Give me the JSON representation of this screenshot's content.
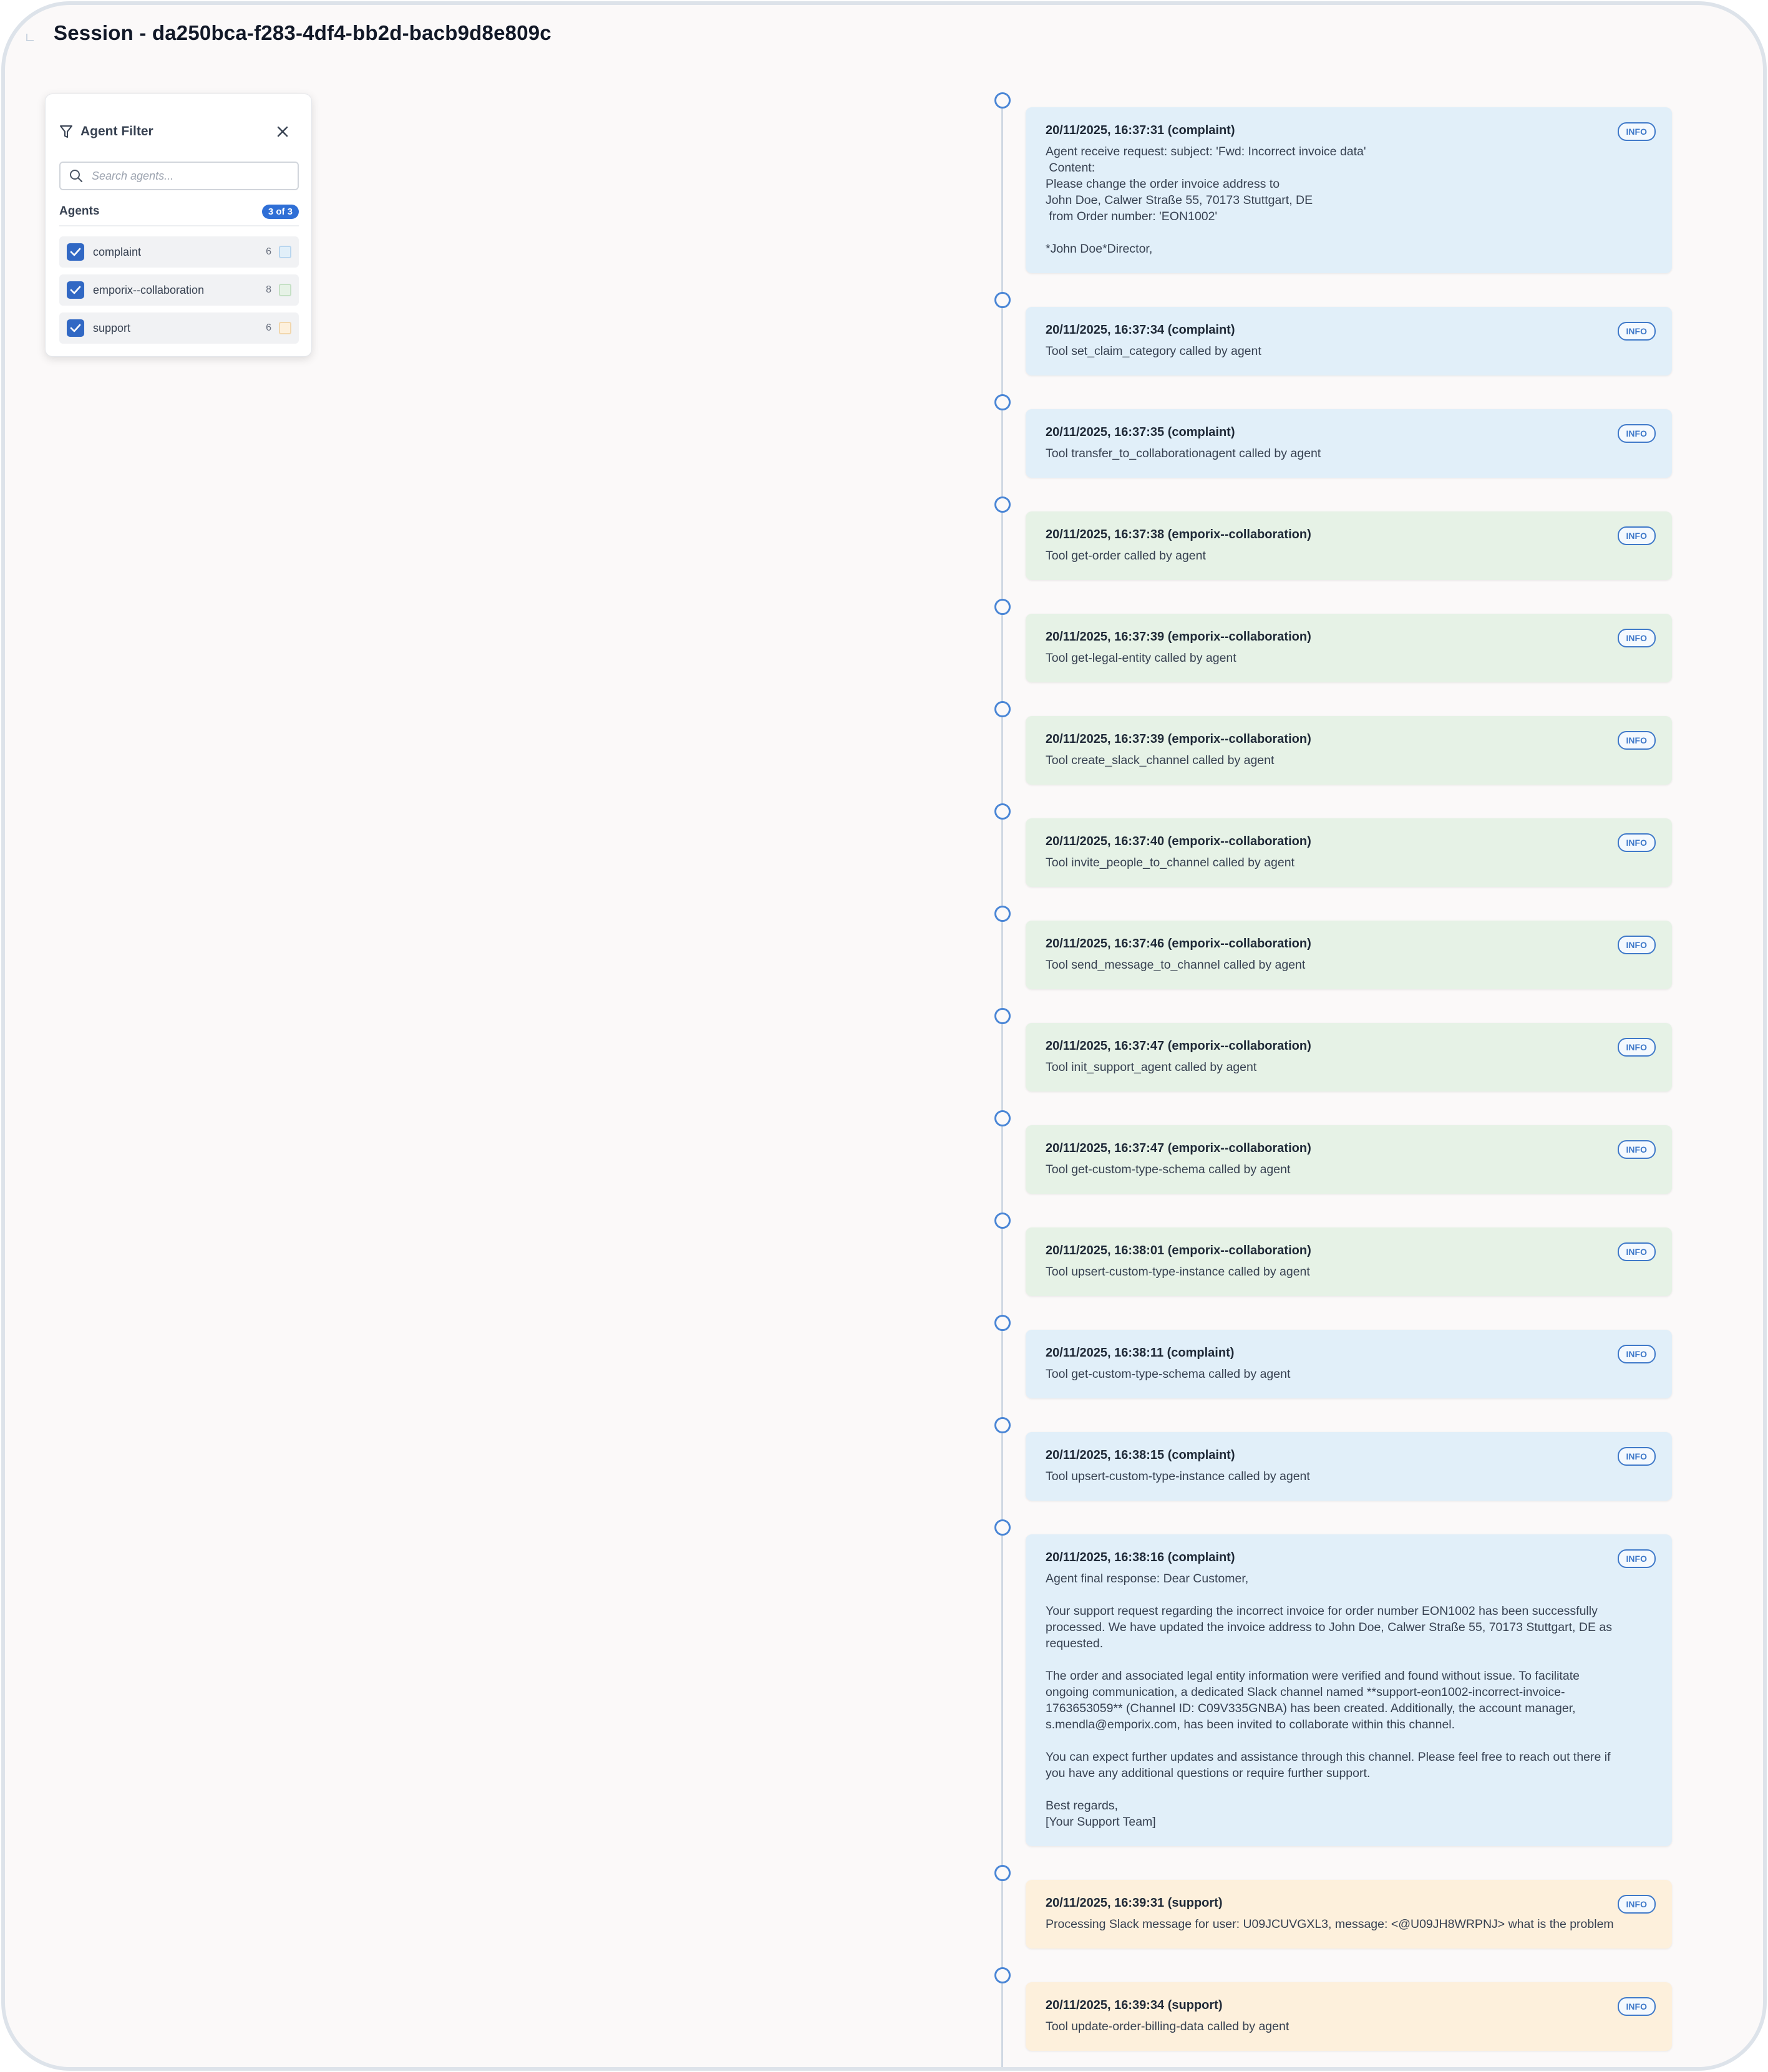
{
  "page": {
    "title": "Session - da250bca-f283-4df4-bb2d-bacb9d8e809c"
  },
  "filter": {
    "title": "Agent Filter",
    "search_placeholder": "Search agents...",
    "agents_label": "Agents",
    "count_badge": "3 of 3",
    "agents": [
      {
        "name": "complaint",
        "count": "6",
        "checked": true,
        "color": "#e1eff9"
      },
      {
        "name": "emporix--collaboration",
        "count": "8",
        "checked": true,
        "color": "#e6f2e6"
      },
      {
        "name": "support",
        "count": "6",
        "checked": true,
        "color": "#fdf0dc"
      }
    ]
  },
  "colors": {
    "complaint": "#e1eff9",
    "emporix": "#e6f2e6",
    "support": "#fdf0dc",
    "accent": "#2f6fd6",
    "badge": "#3f79c9"
  },
  "logs": [
    {
      "timestamp": "20/11/2025, 16:37:31 (complaint)",
      "level": "INFO",
      "agent": "complaint",
      "message": "Agent receive request: subject: 'Fwd: Incorrect invoice data'\n Content:\nPlease change the order invoice address to\nJohn Doe, Calwer Straße 55, 70173 Stuttgart, DE\n from Order number: 'EON1002'\n\n*John Doe*Director,"
    },
    {
      "timestamp": "20/11/2025, 16:37:34 (complaint)",
      "level": "INFO",
      "agent": "complaint",
      "message": "Tool set_claim_category called by agent"
    },
    {
      "timestamp": "20/11/2025, 16:37:35 (complaint)",
      "level": "INFO",
      "agent": "complaint",
      "message": "Tool transfer_to_collaborationagent called by agent"
    },
    {
      "timestamp": "20/11/2025, 16:37:38 (emporix--collaboration)",
      "level": "INFO",
      "agent": "emporix",
      "message": "Tool get-order called by agent"
    },
    {
      "timestamp": "20/11/2025, 16:37:39 (emporix--collaboration)",
      "level": "INFO",
      "agent": "emporix",
      "message": "Tool get-legal-entity called by agent"
    },
    {
      "timestamp": "20/11/2025, 16:37:39 (emporix--collaboration)",
      "level": "INFO",
      "agent": "emporix",
      "message": "Tool create_slack_channel called by agent"
    },
    {
      "timestamp": "20/11/2025, 16:37:40 (emporix--collaboration)",
      "level": "INFO",
      "agent": "emporix",
      "message": "Tool invite_people_to_channel called by agent"
    },
    {
      "timestamp": "20/11/2025, 16:37:46 (emporix--collaboration)",
      "level": "INFO",
      "agent": "emporix",
      "message": "Tool send_message_to_channel called by agent"
    },
    {
      "timestamp": "20/11/2025, 16:37:47 (emporix--collaboration)",
      "level": "INFO",
      "agent": "emporix",
      "message": "Tool init_support_agent called by agent"
    },
    {
      "timestamp": "20/11/2025, 16:37:47 (emporix--collaboration)",
      "level": "INFO",
      "agent": "emporix",
      "message": "Tool get-custom-type-schema called by agent"
    },
    {
      "timestamp": "20/11/2025, 16:38:01 (emporix--collaboration)",
      "level": "INFO",
      "agent": "emporix",
      "message": "Tool upsert-custom-type-instance called by agent"
    },
    {
      "timestamp": "20/11/2025, 16:38:11 (complaint)",
      "level": "INFO",
      "agent": "complaint",
      "message": "Tool get-custom-type-schema called by agent"
    },
    {
      "timestamp": "20/11/2025, 16:38:15 (complaint)",
      "level": "INFO",
      "agent": "complaint",
      "message": "Tool upsert-custom-type-instance called by agent"
    },
    {
      "timestamp": "20/11/2025, 16:38:16 (complaint)",
      "level": "INFO",
      "agent": "complaint",
      "message": "Agent final response: Dear Customer,\n\nYour support request regarding the incorrect invoice for order number EON1002 has been successfully\nprocessed. We have updated the invoice address to John Doe, Calwer Straße 55, 70173 Stuttgart, DE as\nrequested.\n\nThe order and associated legal entity information were verified and found without issue. To facilitate\nongoing communication, a dedicated Slack channel named **support-eon1002-incorrect-invoice-\n1763653059** (Channel ID: C09V335GNBA) has been created. Additionally, the account manager,\ns.mendla@emporix.com, has been invited to collaborate within this channel.\n\nYou can expect further updates and assistance through this channel. Please feel free to reach out there if\nyou have any additional questions or require further support.\n\nBest regards,\n[Your Support Team]"
    },
    {
      "timestamp": "20/11/2025, 16:39:31 (support)",
      "level": "INFO",
      "agent": "support",
      "message": "Processing Slack message for user: U09JCUVGXL3, message: <@U09JH8WRPNJ> what is the problem"
    },
    {
      "timestamp": "20/11/2025, 16:39:34 (support)",
      "level": "INFO",
      "agent": "support",
      "message": "Tool update-order-billing-data called by agent"
    }
  ]
}
